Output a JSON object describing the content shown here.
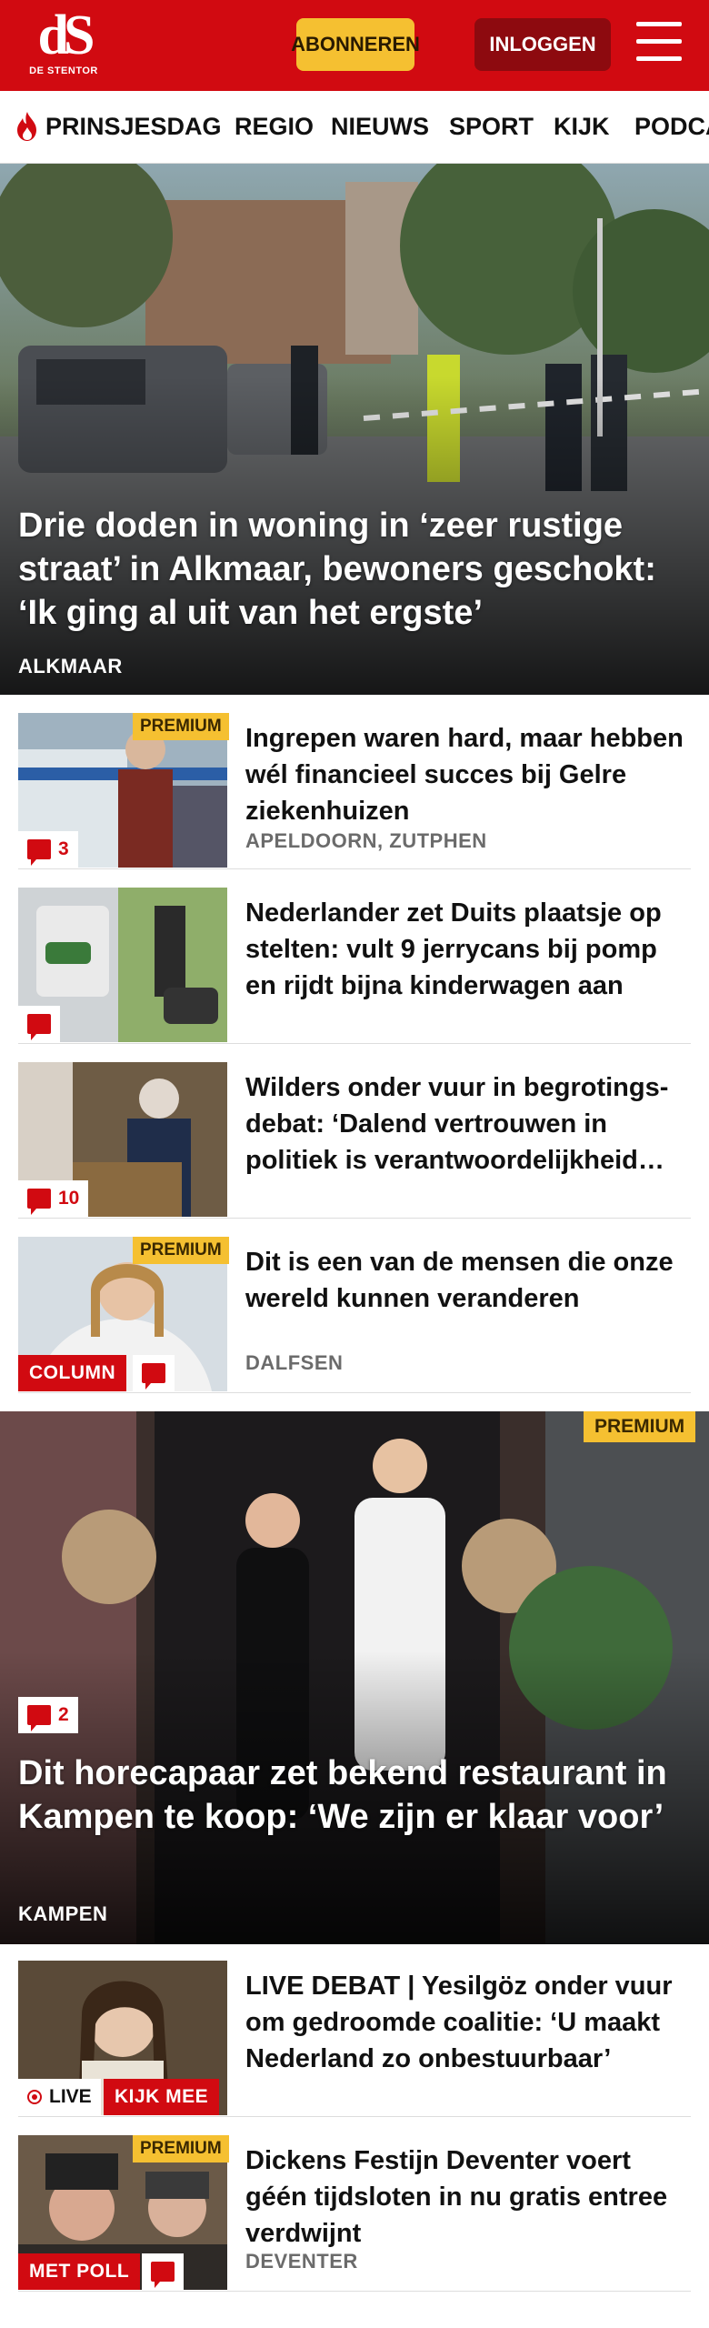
{
  "header": {
    "logo_text": "dS",
    "logo_sub": "DE STENTOR",
    "subscribe_label": "ABONNEREN",
    "login_label": "INLOGGEN"
  },
  "nav": {
    "items": [
      "PRINSJESDAG",
      "REGIO",
      "NIEUWS",
      "SPORT",
      "KIJK",
      "PODCA"
    ]
  },
  "hero1": {
    "title": "Drie doden in woning in ‘zeer rustige straat’ in Alkmaar, bewoners geschokt: ‘Ik ging al uit van het ergste’",
    "location": "ALKMAAR"
  },
  "articles": [
    {
      "title": "Ingrepen waren hard, maar hebben wél financieel succes bij Gelre ziekenhuizen",
      "location": "APELDOORN, ZUTPHEN",
      "premium": "PREMIUM",
      "comments": "3"
    },
    {
      "title": "Nederlander zet Duits plaatsje op stelten: vult 9 jerrycans bij pomp en rijdt bijna kinderwagen aan"
    },
    {
      "title": "Wilders onder vuur in begrotings­debat: ‘Dalend vertrouwen in politiek is verantwoordelijkheid…",
      "comments": "10"
    },
    {
      "title": "Dit is een van de mensen die onze wereld kunnen veranderen",
      "location": "DALFSEN",
      "premium": "PREMIUM",
      "label": "COLUMN"
    }
  ],
  "hero2": {
    "title": "Dit horecapaar zet bekend restaurant in Kampen te koop: ‘We zijn er klaar voor’",
    "location": "KAMPEN",
    "premium": "PREMIUM",
    "comments": "2"
  },
  "articles2": [
    {
      "title": "LIVE DEBAT | Yesilgöz onder vuur om gedroomde coalitie: ‘U maakt Nederland zo onbestuurbaar’",
      "live": "LIVE",
      "label": "KIJK MEE"
    },
    {
      "title": "Dickens Festijn Deventer voert géén tijdsloten in nu gratis entree verdwijnt",
      "location": "DEVENTER",
      "premium": "PREMIUM",
      "label": "MET POLL"
    }
  ],
  "colors": {
    "brand_red": "#d10a11",
    "premium_yellow": "#f5c031",
    "login_dark_red": "#8d0a0f"
  }
}
